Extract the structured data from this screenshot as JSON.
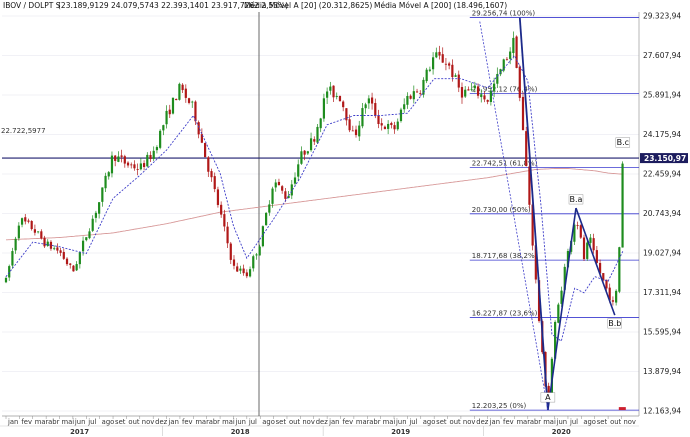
{
  "header": {
    "symbol": "IBOV / DOLPT S",
    "quote": "(23.189,9129  24.079,5743  22.393,1401  23.917,7262  2,53%)",
    "ma20": "Média Móvel A [20] (20.312,8625)",
    "ma200": "Média Móvel A [200] (18.496,1607)"
  },
  "colors": {
    "up": "#1e8c1e",
    "down": "#b01818",
    "ma20": "#3c3cc8",
    "ma200": "#d89a9a",
    "fib": "#3a3acf",
    "wave": "#1c2a8a",
    "price_line": "#1c1c6e",
    "grid": "#e4e4ee"
  },
  "chart_data": {
    "type": "candlestick",
    "y_axis": {
      "ticks": [
        29323.94,
        27607.94,
        25891.94,
        24175.94,
        22459.94,
        20743.94,
        19027.94,
        17311.94,
        15595.94,
        13879.94,
        12163.94
      ],
      "tick_labels": [
        "29.323,94",
        "27.607,94",
        "25.891,94",
        "24.175,94",
        "22.459,94",
        "20.743,94",
        "19.027,94",
        "17.311,94",
        "15.595,94",
        "13.879,94",
        "12.163,94"
      ],
      "current_value": 23150.97,
      "current_label": "23.150,97"
    },
    "x_axis": {
      "months": [
        "jan",
        "fev",
        "mar",
        "abr",
        "mai",
        "jun",
        "jul",
        "ago",
        "set",
        "out",
        "nov",
        "dez",
        "jan",
        "fev",
        "mar",
        "abr",
        "mai",
        "jun",
        "jul",
        "ago",
        "set",
        "out",
        "nov",
        "dez",
        "jan",
        "fev",
        "mar",
        "abr",
        "mai",
        "jun",
        "jul",
        "ago",
        "set",
        "out",
        "nov",
        "dez",
        "jan",
        "fev",
        "mar",
        "abr",
        "mai",
        "jun",
        "jul",
        "ago",
        "set",
        "out",
        "nov",
        "dez"
      ],
      "years": [
        "2017",
        "2018",
        "2019",
        "2020"
      ]
    },
    "left_level_label": "22.722,5977",
    "fib_levels": [
      {
        "value": 29256.74,
        "label": "29.256,74 (100%)"
      },
      {
        "value": 25952.12,
        "label": "25.952,12 (76,4%)"
      },
      {
        "value": 22742.51,
        "label": "22.742,51 (61,8%)"
      },
      {
        "value": 20730.0,
        "label": "20.730,00 (50%)"
      },
      {
        "value": 18717.68,
        "label": "18.717,68 (38,2%)"
      },
      {
        "value": 16227.87,
        "label": "16.227,87 (23,6%)"
      },
      {
        "value": 12203.25,
        "label": "12.203,25 (0%)"
      }
    ],
    "waves": [
      {
        "label": "A",
        "month_index": 40.5,
        "value": 12203
      },
      {
        "label": "B.a",
        "month_index": 42.6,
        "value": 20980
      },
      {
        "label": "B.b",
        "month_index": 45.5,
        "value": 16330
      },
      {
        "label": "B.c",
        "month_index": 46.1,
        "value": 23450
      }
    ],
    "impulse_top": {
      "month_index": 38.4,
      "value": 29256
    },
    "price_anchors": [
      [
        0,
        17800
      ],
      [
        1,
        20500
      ],
      [
        2,
        20100
      ],
      [
        3,
        19400
      ],
      [
        4,
        19100
      ],
      [
        5,
        18200
      ],
      [
        6,
        19800
      ],
      [
        7,
        21300
      ],
      [
        8,
        23300
      ],
      [
        9,
        22900
      ],
      [
        10,
        22700
      ],
      [
        11,
        23400
      ],
      [
        12,
        25000
      ],
      [
        13,
        26200
      ],
      [
        14,
        25300
      ],
      [
        15,
        23000
      ],
      [
        16,
        20800
      ],
      [
        17,
        18400
      ],
      [
        18,
        18100
      ],
      [
        19,
        19500
      ],
      [
        20,
        22200
      ],
      [
        21,
        21400
      ],
      [
        22,
        23200
      ],
      [
        23,
        24000
      ],
      [
        24,
        26100
      ],
      [
        25,
        25800
      ],
      [
        26,
        24000
      ],
      [
        27,
        25800
      ],
      [
        28,
        24600
      ],
      [
        29,
        24400
      ],
      [
        30,
        25800
      ],
      [
        31,
        26200
      ],
      [
        32,
        27600
      ],
      [
        33,
        27300
      ],
      [
        34,
        26000
      ],
      [
        35,
        26100
      ],
      [
        36,
        25700
      ],
      [
        37,
        27000
      ],
      [
        38,
        28300
      ],
      [
        39,
        22000
      ],
      [
        40,
        15000
      ],
      [
        40.5,
        12400
      ],
      [
        41,
        15800
      ],
      [
        41.8,
        18500
      ],
      [
        42.6,
        20700
      ],
      [
        43.2,
        18800
      ],
      [
        43.6,
        19700
      ],
      [
        44,
        18800
      ],
      [
        44.5,
        18000
      ],
      [
        45.5,
        16600
      ],
      [
        45.8,
        18700
      ],
      [
        46.1,
        23300
      ]
    ],
    "ma20_anchors": [
      [
        0,
        18000
      ],
      [
        2,
        19500
      ],
      [
        4,
        19300
      ],
      [
        6,
        19000
      ],
      [
        8,
        21400
      ],
      [
        10,
        22400
      ],
      [
        12,
        23500
      ],
      [
        14,
        25000
      ],
      [
        16,
        22500
      ],
      [
        17,
        20200
      ],
      [
        18,
        18800
      ],
      [
        20,
        20500
      ],
      [
        22,
        22300
      ],
      [
        24,
        24600
      ],
      [
        26,
        25000
      ],
      [
        28,
        25000
      ],
      [
        30,
        25100
      ],
      [
        32,
        26600
      ],
      [
        34,
        26600
      ],
      [
        36,
        26200
      ],
      [
        38,
        27600
      ],
      [
        39,
        26500
      ],
      [
        40,
        21000
      ],
      [
        40.8,
        15500
      ],
      [
        41.5,
        15200
      ],
      [
        42.5,
        17500
      ],
      [
        43.2,
        17300
      ],
      [
        44,
        18000
      ],
      [
        45,
        17800
      ],
      [
        46.1,
        19100
      ]
    ],
    "ma200_anchors": [
      [
        0,
        19600
      ],
      [
        4,
        19700
      ],
      [
        8,
        19900
      ],
      [
        12,
        20300
      ],
      [
        16,
        20800
      ],
      [
        20,
        21100
      ],
      [
        24,
        21400
      ],
      [
        28,
        21700
      ],
      [
        32,
        22000
      ],
      [
        36,
        22300
      ],
      [
        39.5,
        22650
      ],
      [
        41,
        22700
      ],
      [
        42,
        22700
      ],
      [
        43,
        22650
      ],
      [
        44,
        22600
      ],
      [
        45,
        22500
      ],
      [
        46.1,
        22450
      ]
    ]
  }
}
